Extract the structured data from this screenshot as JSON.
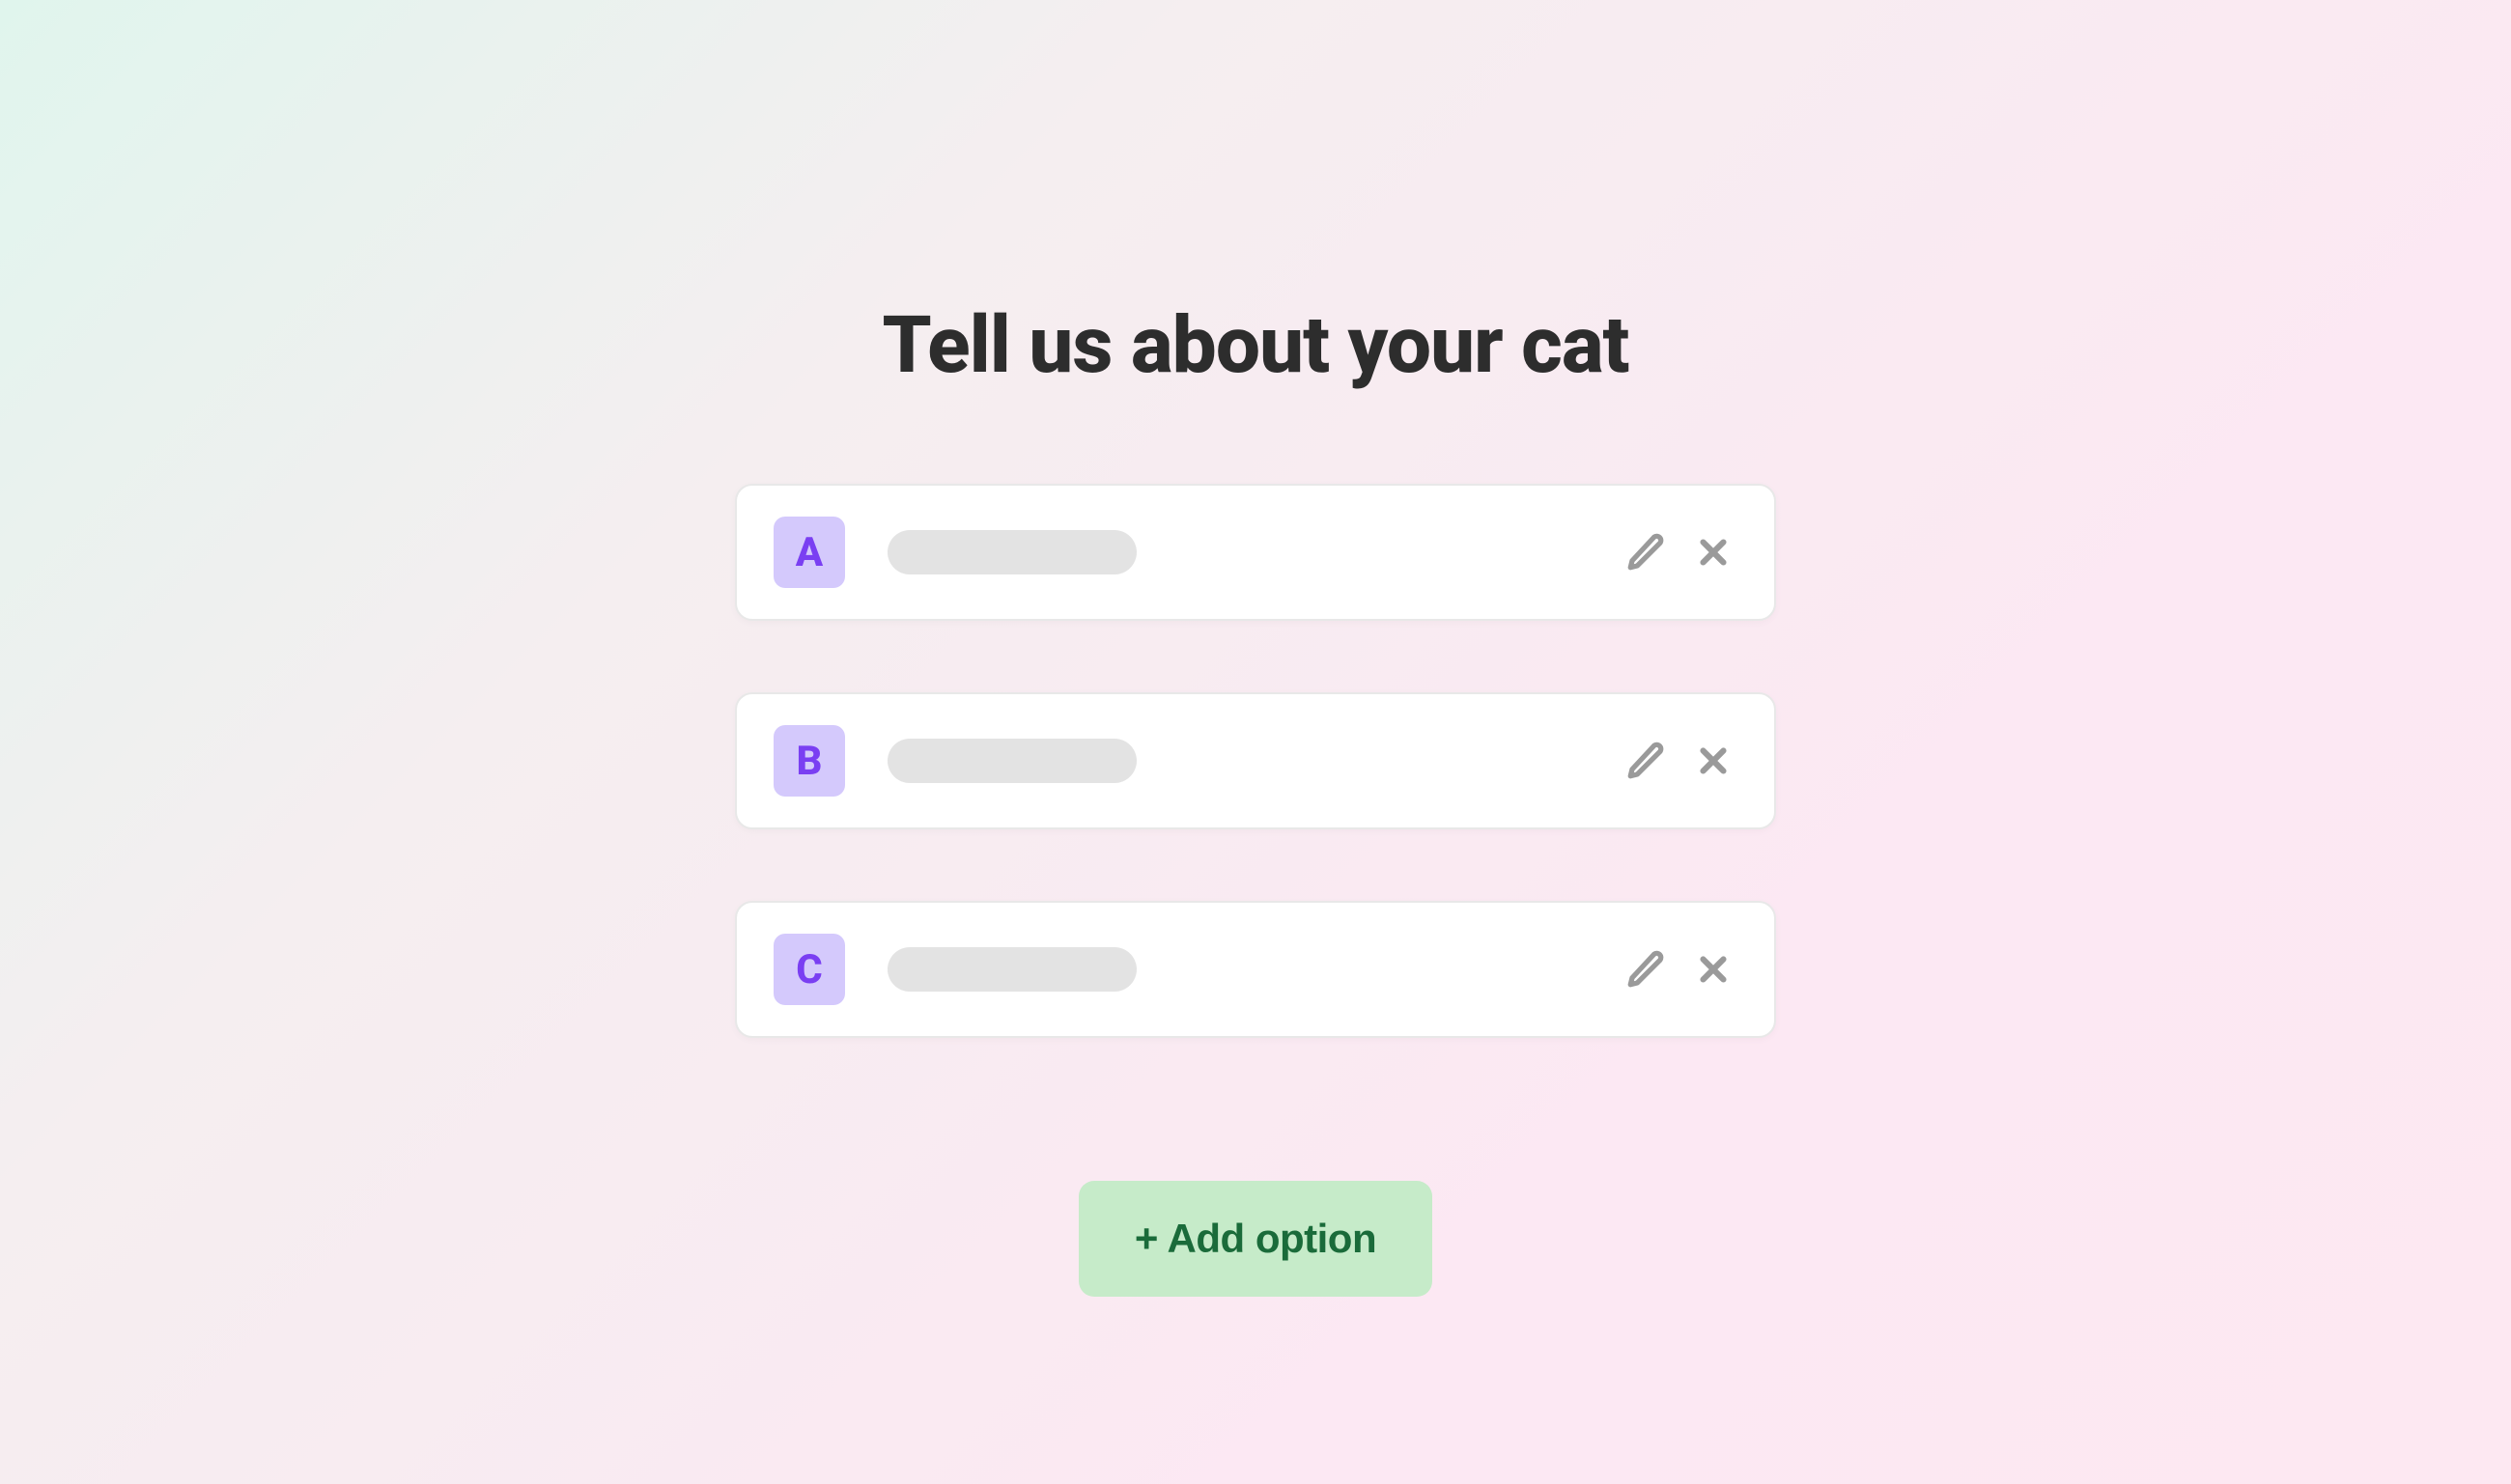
{
  "heading": "Tell us about your cat",
  "options": [
    {
      "letter": "A"
    },
    {
      "letter": "B"
    },
    {
      "letter": "C"
    }
  ],
  "addButton": {
    "label": "+ Add option"
  },
  "colors": {
    "badgeBg": "#d4c9fc",
    "badgeText": "#7a3ff2",
    "addBg": "#c6ebc9",
    "addText": "#1a6b3a"
  }
}
